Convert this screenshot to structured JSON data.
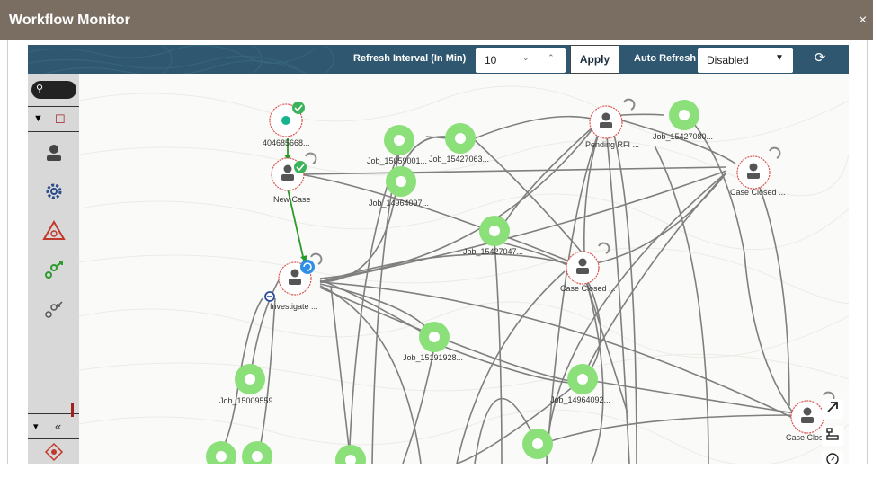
{
  "window": {
    "title": "Workflow Monitor",
    "close_glyph": "×"
  },
  "toolbar": {
    "refresh_interval_label": "Refresh Interval (In Min)",
    "refresh_interval_value": "10",
    "apply_label": "Apply",
    "auto_refresh_label": "Auto Refresh",
    "auto_refresh_value": "Disabled",
    "refresh_icon": "refresh-icon"
  },
  "sidebar": {
    "search_icon": "search-icon",
    "tools": [
      "person-icon",
      "gear-icon",
      "warning-icon",
      "expand-flow-icon",
      "collapse-flow-icon"
    ],
    "bottom": {
      "toggle": "▾",
      "collapse": "«",
      "compass": "compass-icon"
    }
  },
  "nodes": [
    {
      "id": "n1",
      "label": "404685668...",
      "kind": "start-status"
    },
    {
      "id": "n2",
      "label": "New Case",
      "kind": "human"
    },
    {
      "id": "n3",
      "label": "Investigate ...",
      "kind": "human"
    },
    {
      "id": "n4",
      "label": "Job_15059001...",
      "kind": "job"
    },
    {
      "id": "n5",
      "label": "Job_15427063...",
      "kind": "job"
    },
    {
      "id": "n6",
      "label": "Job_14964097...",
      "kind": "job"
    },
    {
      "id": "n7",
      "label": "Pending RFI ...",
      "kind": "human"
    },
    {
      "id": "n8",
      "label": "Job_15427080...",
      "kind": "job"
    },
    {
      "id": "n9",
      "label": "Case Closed ...",
      "kind": "human"
    },
    {
      "id": "n10",
      "label": "Job_15427047...",
      "kind": "job"
    },
    {
      "id": "n11",
      "label": "Case Closed ...",
      "kind": "human"
    },
    {
      "id": "n12",
      "label": "Job_15191928...",
      "kind": "job"
    },
    {
      "id": "n13",
      "label": "Job_15009559...",
      "kind": "job"
    },
    {
      "id": "n14",
      "label": "Job_14964092...",
      "kind": "job"
    },
    {
      "id": "n15",
      "label": "Case Close...",
      "kind": "human"
    }
  ],
  "canvas_tools": [
    "arrow-up-right-icon",
    "layout-icon",
    "compass-icon"
  ],
  "colors": {
    "titlebar": "#7a6e63",
    "toolbar": "#2f5870",
    "job": "#8be07a",
    "edge": "#7f7f7f",
    "active_edge": "#2a9a2a",
    "status_ok": "#3bb35a",
    "status_running": "#2f8fe8"
  }
}
